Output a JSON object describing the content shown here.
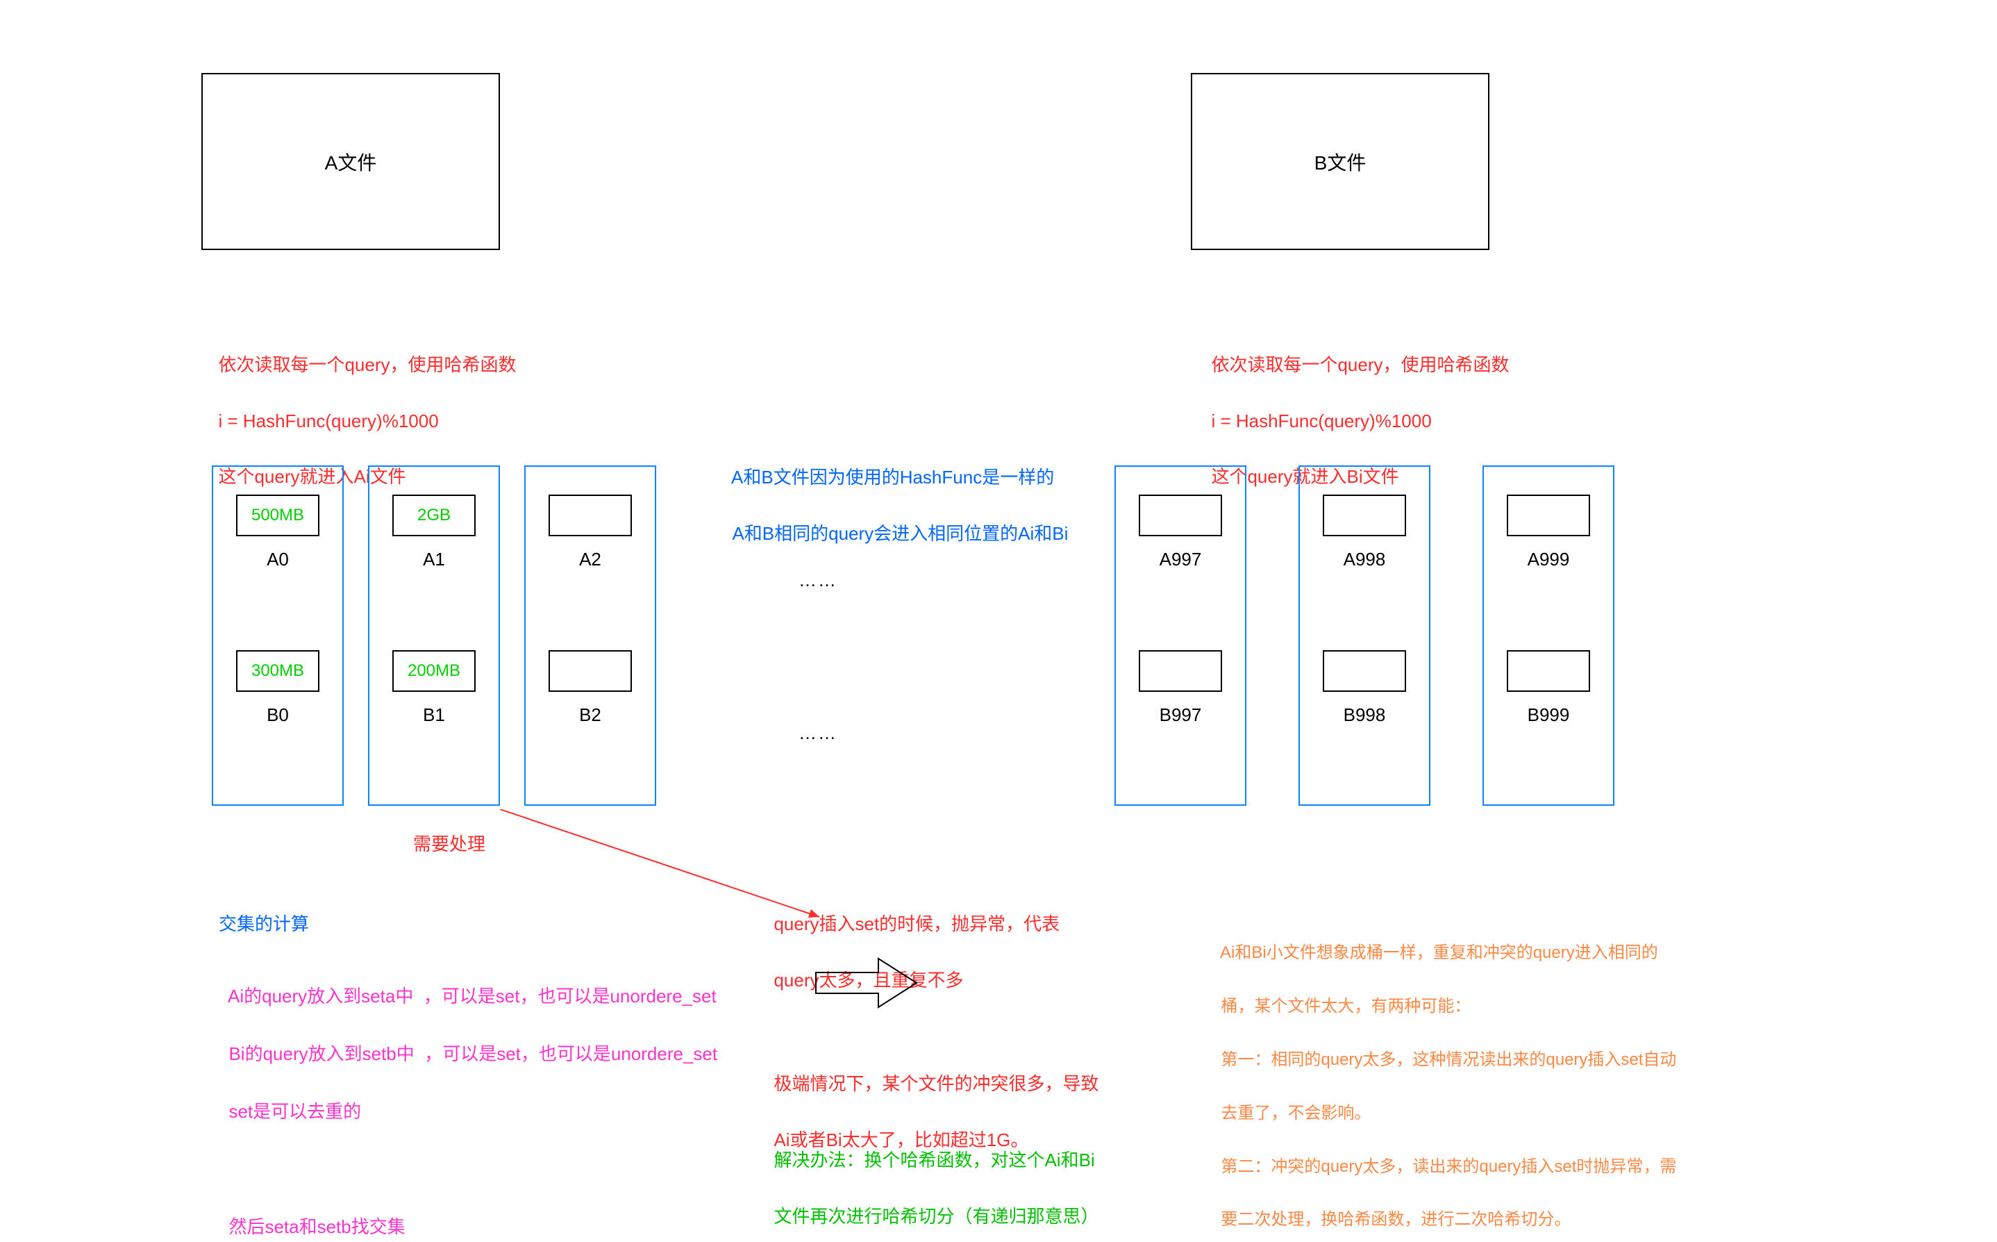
{
  "fileA": {
    "label": "A文件"
  },
  "fileB": {
    "label": "B文件"
  },
  "hashTextA": {
    "line1": "依次读取每一个query，使用哈希函数",
    "line2": "i = HashFunc(query)%1000",
    "line3": "这个query就进入Ai文件"
  },
  "hashTextB": {
    "line1": "依次读取每一个query，使用哈希函数",
    "line2": "i = HashFunc(query)%1000",
    "line3": "这个query就进入Bi文件"
  },
  "midTextBlue": {
    "line1": "A和B文件因为使用的HashFunc是一样的",
    "line2": "A和B相同的query会进入相同位置的Ai和Bi"
  },
  "buckets": {
    "left": [
      {
        "topSize": "500MB",
        "topLabel": "A0",
        "botSize": "300MB",
        "botLabel": "B0"
      },
      {
        "topSize": "2GB",
        "topLabel": "A1",
        "botSize": "200MB",
        "botLabel": "B1"
      },
      {
        "topSize": "",
        "topLabel": "A2",
        "botSize": "",
        "botLabel": "B2"
      }
    ],
    "right": [
      {
        "topSize": "",
        "topLabel": "A997",
        "botSize": "",
        "botLabel": "B997"
      },
      {
        "topSize": "",
        "topLabel": "A998",
        "botSize": "",
        "botLabel": "B998"
      },
      {
        "topSize": "",
        "topLabel": "A999",
        "botSize": "",
        "botLabel": "B999"
      }
    ]
  },
  "dotsTop": "……",
  "dotsBot": "……",
  "needHandle": "需要处理",
  "intersectTitle": "交集的计算",
  "intersectDesc": {
    "line1": "Ai的query放入到seta中  ，可以是set，也可以是unordere_set",
    "line2": "Bi的query放入到setb中  ，可以是set，也可以是unordere_set",
    "line3": "set是可以去重的",
    "line4": "",
    "line5": "然后seta和setb找交集"
  },
  "exceptionTop": {
    "line1": "query插入set的时候，抛异常，代表",
    "line2": "query太多，且重复不多"
  },
  "exceptionBot": {
    "line1": "极端情况下，某个文件的冲突很多，导致",
    "line2": "Ai或者Bi太大了，比如超过1G。"
  },
  "solution": {
    "line1": "解决办法：换个哈希函数，对这个Ai和Bi",
    "line2": "文件再次进行哈希切分（有递归那意思）"
  },
  "bucketExplain": {
    "line1": "Ai和Bi小文件想象成桶一样，重复和冲突的query进入相同的",
    "line2": "桶，某个文件太大，有两种可能：",
    "line3": "第一：相同的query太多，这种情况读出来的query插入set自动",
    "line4": "去重了，不会影响。",
    "line5": "第二：冲突的query太多，读出来的query插入set时抛异常，需",
    "line6": "要二次处理，换哈希函数，进行二次哈希切分。"
  }
}
